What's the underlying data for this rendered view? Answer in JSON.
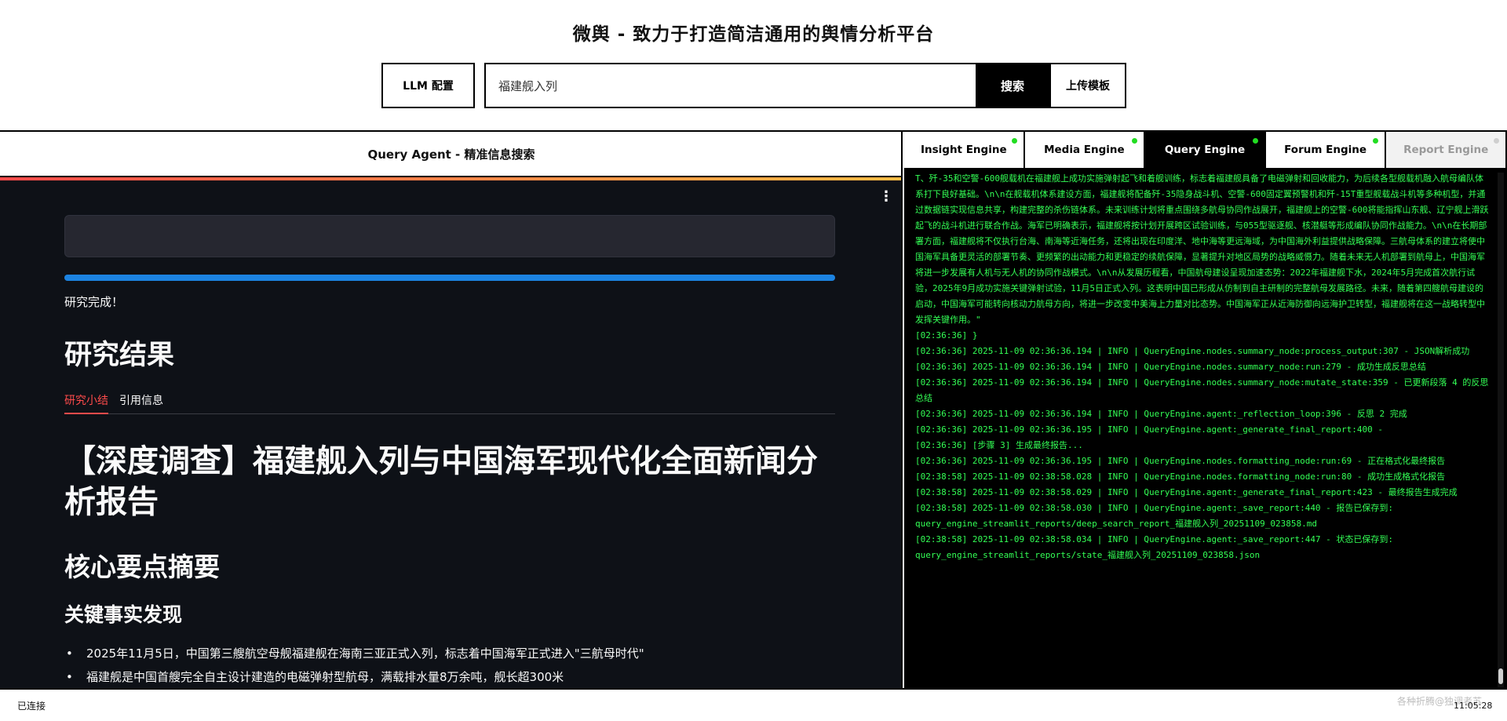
{
  "header": {
    "title": "微舆 - 致力于打造简洁通用的舆情分析平台",
    "llm_button": "LLM 配置",
    "search_value": "福建舰入列",
    "search_button": "搜索",
    "upload_button": "上传模板"
  },
  "left_panel": {
    "title": "Query Agent - 精准信息搜索",
    "progress_percent": 100,
    "status": "研究完成！",
    "results_heading": "研究结果",
    "tabs": [
      "研究小结",
      "引用信息"
    ],
    "active_tab": "研究小结",
    "report_title": "【深度调查】福建舰入列与中国海军现代化全面新闻分析报告",
    "section_heading": "核心要点摘要",
    "subsection_heading": "关键事实发现",
    "bullets": [
      "2025年11月5日，中国第三艘航空母舰福建舰在海南三亚正式入列，标志着中国海军正式进入\"三航母时代\"",
      "福建舰是中国首艘完全自主设计建造的电磁弹射型航母，满载排水量8万余吨，舰长超300米"
    ]
  },
  "right_panel": {
    "engine_tabs": [
      {
        "label": "Insight Engine",
        "status": "online"
      },
      {
        "label": "Media Engine",
        "status": "online"
      },
      {
        "label": "Query Engine",
        "status": "online",
        "active": true
      },
      {
        "label": "Forum Engine",
        "status": "online"
      },
      {
        "label": "Report Engine",
        "status": "offline",
        "disabled": true
      }
    ],
    "log_paragraph": "T、歼-35和空警-600舰载机在福建舰上成功实施弹射起飞和着舰训练，标志着福建舰具备了电磁弹射和回收能力，为后续各型舰载机融入航母编队体系打下良好基础。\\n\\n在舰载机体系建设方面，福建舰将配备歼-35隐身战斗机、空警-600固定翼预警机和歼-15T重型舰载战斗机等多种机型，并通过数据链实现信息共享，构建完整的杀伤链体系。未来训练计划将重点围绕多航母协同作战展开，福建舰上的空警-600将能指挥山东舰、辽宁舰上滑跃起飞的战斗机进行联合作战。海军已明确表示，福建舰将按计划开展跨区试验训练，与055型驱逐舰、核潜艇等形成编队协同作战能力。\\n\\n在长期部署方面，福建舰将不仅执行台海、南海等近海任务，还将出现在印度洋、地中海等更远海域，为中国海外利益提供战略保障。三航母体系的建立将使中国海军具备更灵活的部署节奏、更频繁的出动能力和更稳定的续航保障，显著提升对地区局势的战略威慑力。随着未来无人机部署到航母上，中国海军将进一步发展有人机与无人机的协同作战模式。\\n\\n从发展历程看，中国航母建设呈现加速态势：2022年福建舰下水，2024年5月完成首次航行试验，2025年9月成功实施关键弹射试验，11月5日正式入列。这表明中国已形成从仿制到自主研制的完整航母发展路径。未来，随着第四艘航母建设的启动，中国海军可能转向核动力航母方向，将进一步改变中美海上力量对比态势。中国海军正从近海防御向远海护卫转型，福建舰将在这一战略转型中发挥关键作用。\"",
    "log_lines": [
      "[02:36:36] }",
      "[02:36:36] 2025-11-09 02:36:36.194 | INFO     | QueryEngine.nodes.summary_node:process_output:307 - JSON解析成功",
      "[02:36:36] 2025-11-09 02:36:36.194 | INFO     | QueryEngine.nodes.summary_node:run:279 - 成功生成反思总结",
      "[02:36:36] 2025-11-09 02:36:36.194 | INFO     | QueryEngine.nodes.summary_node:mutate_state:359 - 已更新段落 4 的反思总结",
      "[02:36:36] 2025-11-09 02:36:36.194 | INFO     | QueryEngine.agent:_reflection_loop:396 -     反思 2 完成",
      "[02:36:36] 2025-11-09 02:36:36.195 | INFO     | QueryEngine.agent:_generate_final_report:400 -",
      "[02:36:36] [步骤 3] 生成最终报告...",
      "[02:36:36] 2025-11-09 02:36:36.195 | INFO     | QueryEngine.nodes.formatting_node:run:69 - 正在格式化最终报告",
      "[02:38:58] 2025-11-09 02:38:58.028 | INFO     | QueryEngine.nodes.formatting_node:run:80 - 成功生成格式化报告",
      "[02:38:58] 2025-11-09 02:38:58.029 | INFO     | QueryEngine.agent:_generate_final_report:423 - 最终报告生成完成",
      "[02:38:58] 2025-11-09 02:38:58.030 | INFO     | QueryEngine.agent:_save_report:440 - 报告已保存到: query_engine_streamlit_reports/deep_search_report_福建舰入列_20251109_023858.md",
      "[02:38:58] 2025-11-09 02:38:58.034 | INFO     | QueryEngine.agent:_save_report:447 - 状态已保存到: query_engine_streamlit_reports/state_福建舰入列_20251109_023858.json"
    ]
  },
  "status_bar": {
    "connection": "已连接",
    "time": "11:05:28",
    "watermark": "各种折腾@独调者苏"
  },
  "colors": {
    "log_text": "#33ff55",
    "online_dot": "#22dd22",
    "progress": "#1c83e1",
    "accent": "#ff4b4b",
    "dark_bg": "#0e1117"
  }
}
